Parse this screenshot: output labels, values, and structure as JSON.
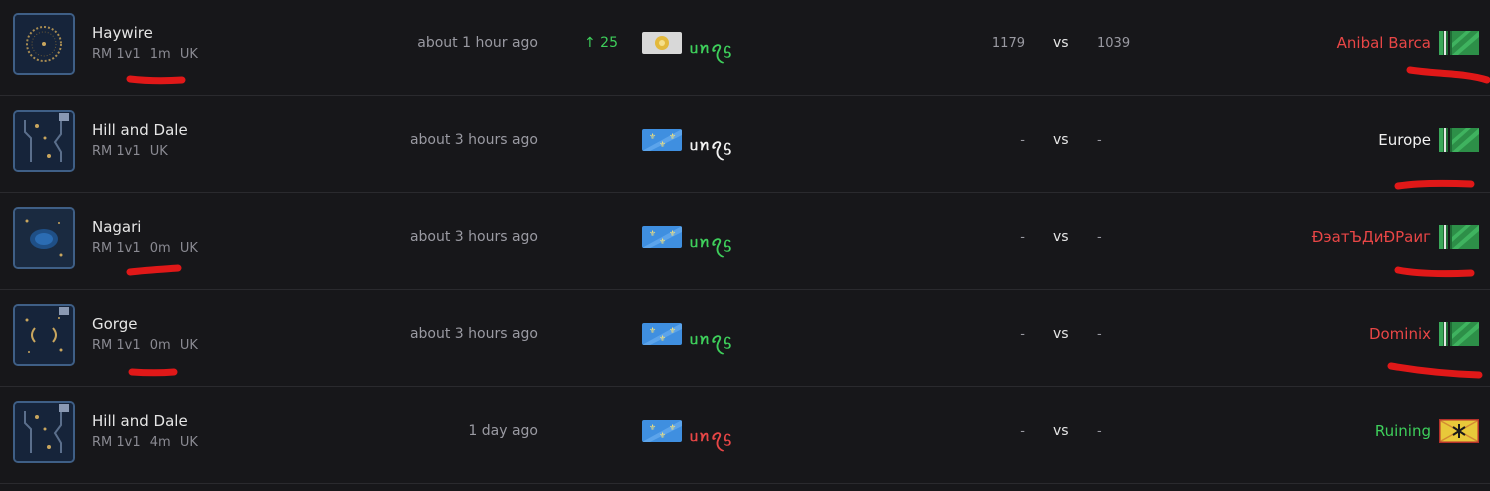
{
  "colors": {
    "background": "#17171a",
    "win": "#3ecf5b",
    "loss": "#e84646",
    "neutral": "#f2f2f2",
    "annotation": "#e01818"
  },
  "matches": [
    {
      "map": "Haywire",
      "mode": "RM 1v1",
      "duration": "1m",
      "server": "UK",
      "time": "about 1 hour ago",
      "rating_change": "↑ 25",
      "p1_flag": "byzantines-flag",
      "p1_name": "ᥙꪀꪖᦓ",
      "p1_color": "green",
      "p1_rating": "1179",
      "vs": "vs",
      "p2_rating": "1039",
      "p2_name": "Anibal Barca",
      "p2_color": "red",
      "p2_flag": "green-white-stripes-flag"
    },
    {
      "map": "Hill and Dale",
      "mode": "RM 1v1",
      "duration": "",
      "server": "UK",
      "time": "about 3 hours ago",
      "rating_change": "",
      "p1_flag": "fleur-de-lis-flag",
      "p1_name": "ᥙꪀꪖᦓ",
      "p1_color": "white",
      "p1_rating": "-",
      "vs": "vs",
      "p2_rating": "-",
      "p2_name": "Europe",
      "p2_color": "white",
      "p2_flag": "green-white-stripes-flag"
    },
    {
      "map": "Nagari",
      "mode": "RM 1v1",
      "duration": "0m",
      "server": "UK",
      "time": "about 3 hours ago",
      "rating_change": "",
      "p1_flag": "fleur-de-lis-flag",
      "p1_name": "ᥙꪀꪖᦓ",
      "p1_color": "green",
      "p1_rating": "-",
      "vs": "vs",
      "p2_rating": "-",
      "p2_name": "ÐэатЪДиÐРаиг",
      "p2_color": "red",
      "p2_flag": "green-white-stripes-flag"
    },
    {
      "map": "Gorge",
      "mode": "RM 1v1",
      "duration": "0m",
      "server": "UK",
      "time": "about 3 hours ago",
      "rating_change": "",
      "p1_flag": "fleur-de-lis-flag",
      "p1_name": "ᥙꪀꪖᦓ",
      "p1_color": "green",
      "p1_rating": "-",
      "vs": "vs",
      "p2_rating": "-",
      "p2_name": "Dominix",
      "p2_color": "red",
      "p2_flag": "green-white-stripes-flag"
    },
    {
      "map": "Hill and Dale",
      "mode": "RM 1v1",
      "duration": "4m",
      "server": "UK",
      "time": "1 day ago",
      "rating_change": "",
      "p1_flag": "fleur-de-lis-flag",
      "p1_name": "ᥙꪀꪖᦓ",
      "p1_color": "red",
      "p1_rating": "-",
      "vs": "vs",
      "p2_rating": "-",
      "p2_name": "Ruining",
      "p2_color": "green",
      "p2_flag": "amazigh-flag"
    }
  ]
}
